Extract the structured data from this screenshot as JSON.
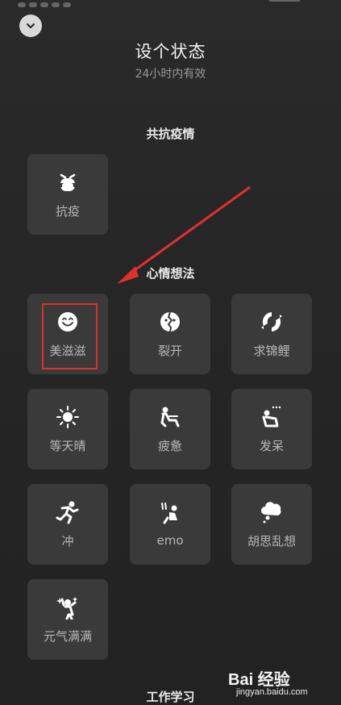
{
  "header": {
    "title": "设个状态",
    "subtitle": "24小时内有效"
  },
  "sections": {
    "epidemic": {
      "title": "共抗疫情",
      "items": [
        {
          "label": "抗疫",
          "icon": "mask-face-icon"
        }
      ]
    },
    "mood": {
      "title": "心情想法",
      "items": [
        {
          "label": "美滋滋",
          "icon": "smile-icon"
        },
        {
          "label": "裂开",
          "icon": "broken-face-icon"
        },
        {
          "label": "求锦鲤",
          "icon": "koi-icon"
        },
        {
          "label": "等天晴",
          "icon": "sun-icon"
        },
        {
          "label": "疲惫",
          "icon": "tired-person-icon"
        },
        {
          "label": "发呆",
          "icon": "daydream-icon"
        },
        {
          "label": "冲",
          "icon": "running-icon"
        },
        {
          "label": "emo",
          "icon": "emo-icon"
        },
        {
          "label": "胡思乱想",
          "icon": "thought-cloud-icon"
        },
        {
          "label": "元气满满",
          "icon": "energetic-icon"
        }
      ]
    },
    "work": {
      "title": "工作学习"
    }
  },
  "watermark": {
    "logo": "Bai 经验",
    "url": "jingyan.baidu.com"
  },
  "colors": {
    "background": "#262626",
    "tile": "#3a3a3a",
    "highlight": "#e0302f",
    "arrow": "#e0302f"
  }
}
